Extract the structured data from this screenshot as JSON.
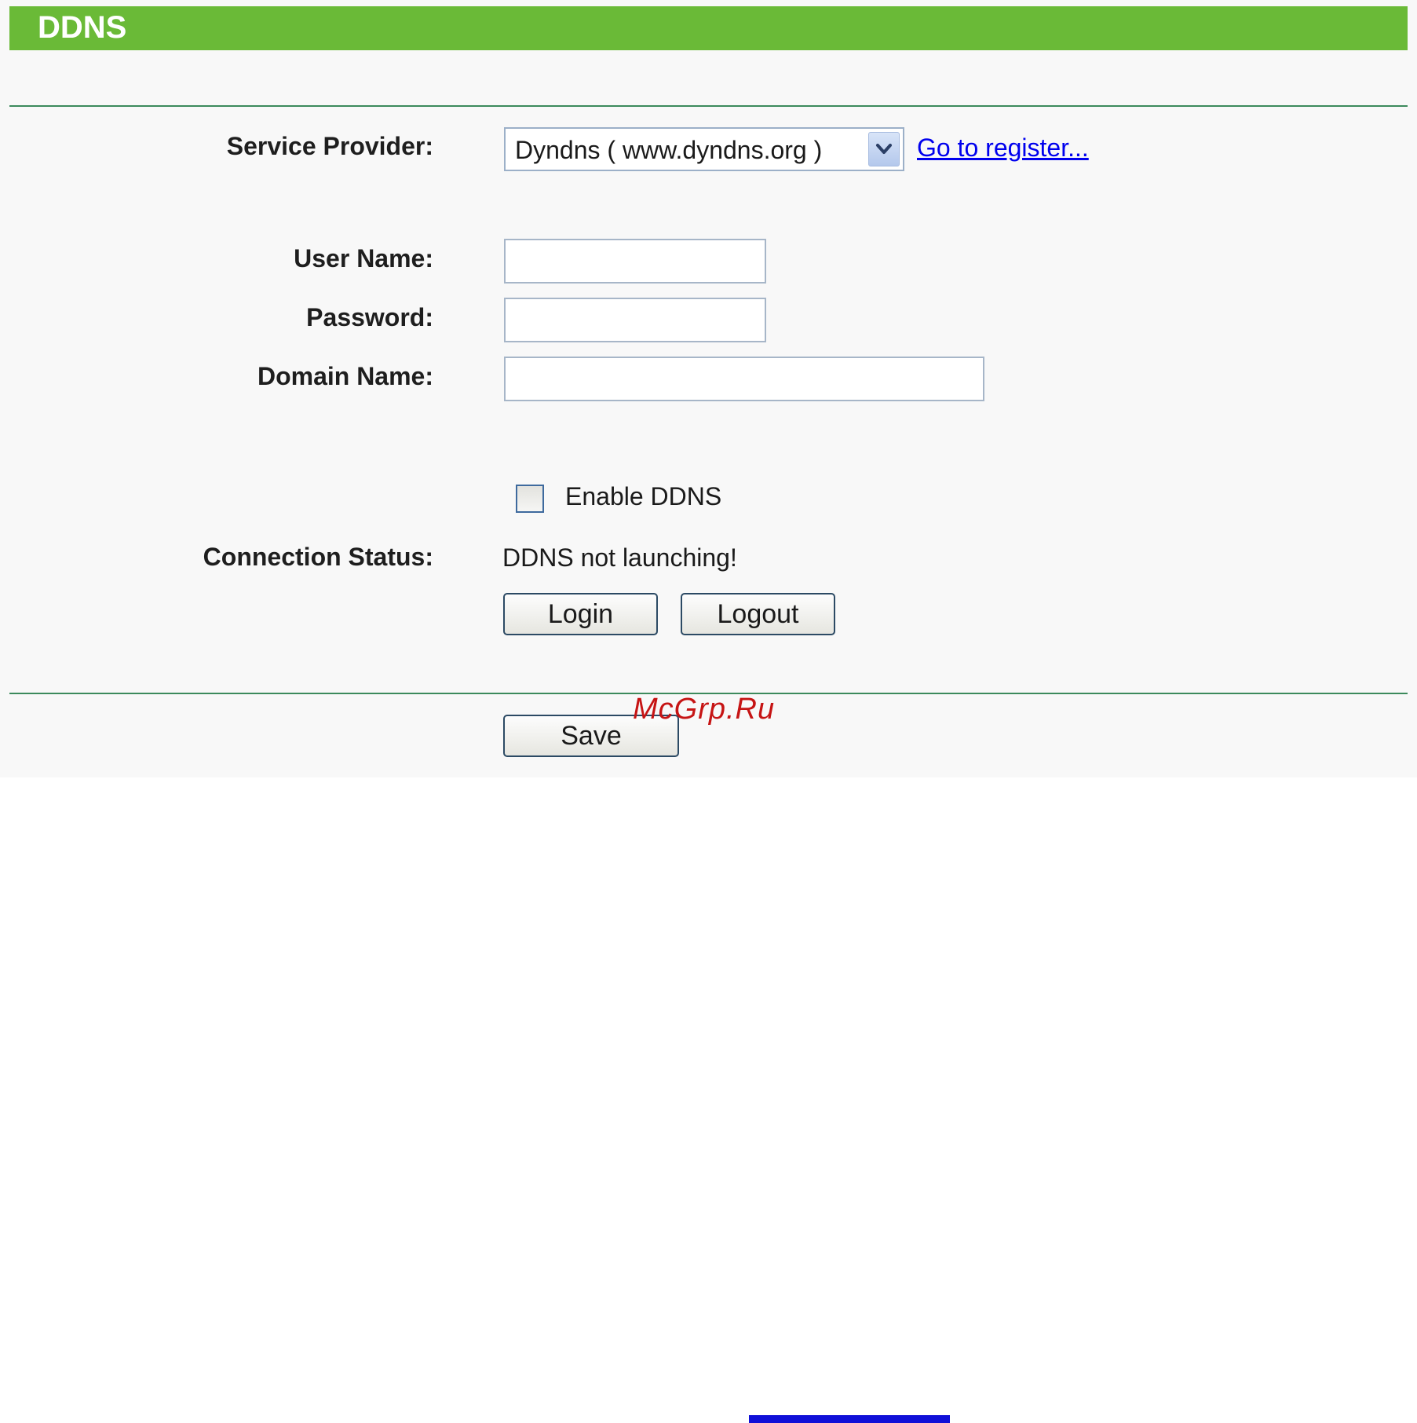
{
  "header": {
    "title": "DDNS"
  },
  "form": {
    "service_provider": {
      "label": "Service Provider:",
      "selected": "Dyndns ( www.dyndns.org )",
      "register_link": "Go to register..."
    },
    "user_name": {
      "label": "User Name:",
      "value": "",
      "placeholder": ""
    },
    "password": {
      "label": "Password:",
      "value": "",
      "placeholder": ""
    },
    "domain_name": {
      "label": "Domain Name:",
      "value": "",
      "placeholder": ""
    },
    "enable_ddns": {
      "label": "Enable DDNS",
      "checked": false
    },
    "connection_status": {
      "label": "Connection Status:",
      "value": "DDNS not launching!"
    },
    "buttons": {
      "login": "Login",
      "logout": "Logout",
      "save": "Save"
    }
  },
  "watermark": "McGrp.Ru",
  "icons": {
    "dropdown": "chevron-down-icon"
  },
  "colors": {
    "header_bg": "#6aba37",
    "divider": "#3c8a5c",
    "link": "#0000ee",
    "watermark": "#c61414"
  }
}
